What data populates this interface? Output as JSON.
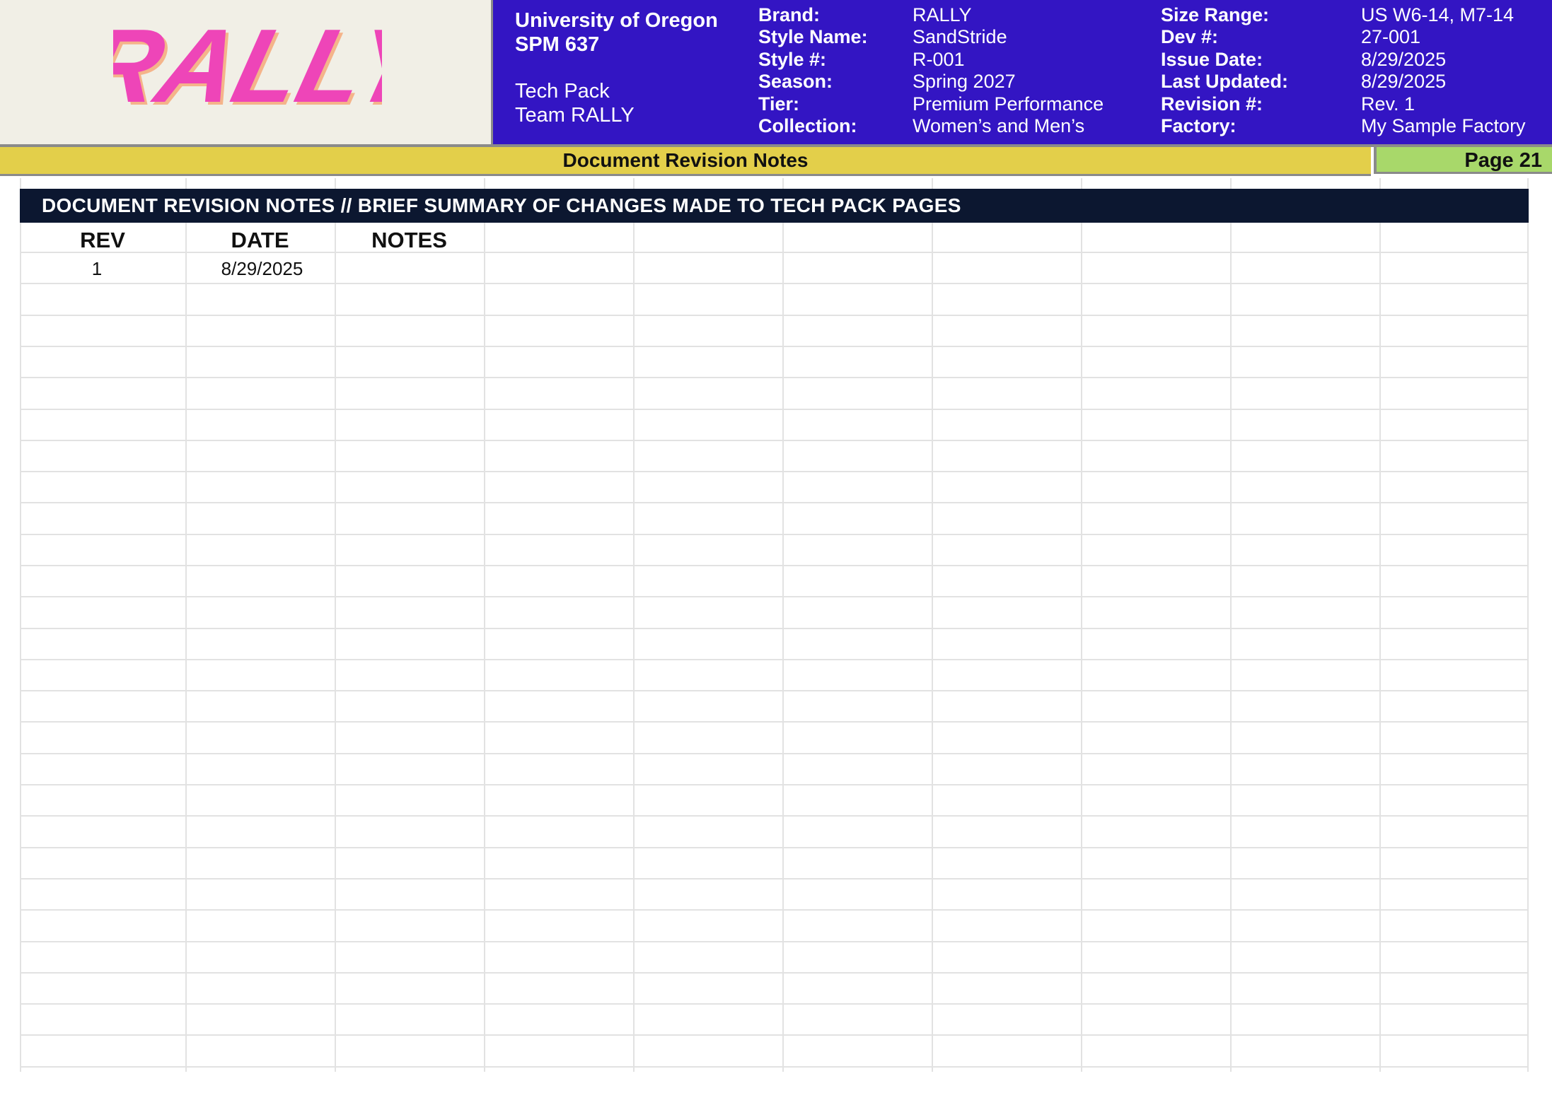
{
  "header": {
    "logo_text": "RALLY",
    "university": "University of Oregon",
    "course": "SPM 637",
    "doc_type": "Tech Pack",
    "team": "Team RALLY",
    "fields_left": [
      {
        "label": "Brand:",
        "value": "RALLY"
      },
      {
        "label": "Style Name:",
        "value": "SandStride"
      },
      {
        "label": "Style #:",
        "value": "R-001"
      },
      {
        "label": "Season:",
        "value": "Spring 2027"
      },
      {
        "label": "Tier:",
        "value": "Premium Performance"
      },
      {
        "label": "Collection:",
        "value": "Women’s and Men’s"
      }
    ],
    "fields_right": [
      {
        "label": "Size Range:",
        "value": "US W6-14, M7-14"
      },
      {
        "label": "Dev #:",
        "value": "27-001"
      },
      {
        "label": "Issue Date:",
        "value": "8/29/2025"
      },
      {
        "label": "Last Updated:",
        "value": "8/29/2025"
      },
      {
        "label": "Revision #:",
        "value": "Rev. 1"
      },
      {
        "label": "Factory:",
        "value": "My Sample Factory"
      }
    ]
  },
  "section_title": "Document Revision Notes",
  "page_label": "Page 21",
  "table": {
    "title": "DOCUMENT REVISION NOTES // BRIEF SUMMARY OF CHANGES MADE TO TECH PACK PAGES",
    "columns": [
      "REV",
      "DATE",
      "NOTES"
    ],
    "rows": [
      {
        "rev": "1",
        "date": "8/29/2025",
        "notes": ""
      }
    ]
  },
  "colors": {
    "header_bg": "#3315c3",
    "logo_bg": "#f1efe6",
    "logo_pink": "#ee45b8",
    "section_bar": "#e3cf4a",
    "page_box": "#a8d86a",
    "title_band": "#0c1730"
  }
}
